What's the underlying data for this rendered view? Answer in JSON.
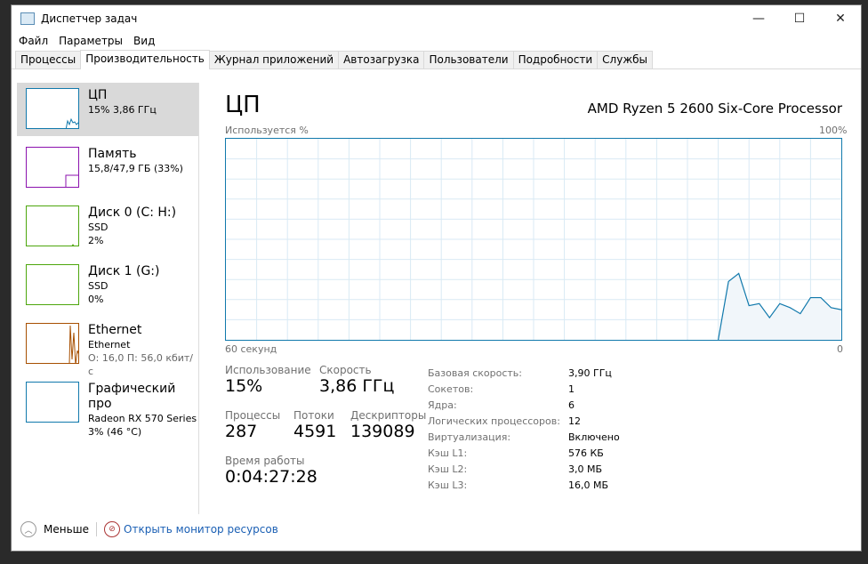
{
  "window": {
    "title": "Диспетчер задач",
    "minimize": "—",
    "maximize": "☐",
    "close": "✕"
  },
  "menu": [
    "Файл",
    "Параметры",
    "Вид"
  ],
  "tabs": [
    "Процессы",
    "Производительность",
    "Журнал приложений",
    "Автозагрузка",
    "Пользователи",
    "Подробности",
    "Службы"
  ],
  "devices": [
    {
      "name": "ЦП",
      "line1": "15% 3,86 ГГц",
      "line2": "",
      "color": "#1179ac"
    },
    {
      "name": "Память",
      "line1": "15,8/47,9 ГБ (33%)",
      "line2": "",
      "color": "#8b12ae"
    },
    {
      "name": "Диск 0 (C: H:)",
      "line1": "SSD",
      "line2": "2%",
      "color": "#4da60c"
    },
    {
      "name": "Диск 1 (G:)",
      "line1": "SSD",
      "line2": "0%",
      "color": "#4da60c"
    },
    {
      "name": "Ethernet",
      "line1": "Ethernet",
      "line2": "О: 16,0 П: 56,0 кбит/с",
      "color": "#a74f01"
    },
    {
      "name": "Графический про",
      "line1": "Radeon RX 570 Series",
      "line2": "3% (46 °C)",
      "color": "#1179ac"
    }
  ],
  "main": {
    "title": "ЦП",
    "cpu_name": "AMD Ryzen 5 2600 Six-Core Processor",
    "y_label": "Используется %",
    "y_max": "100%",
    "x_left": "60 секунд",
    "x_right": "0",
    "stats": {
      "usage_label": "Использование",
      "usage": "15%",
      "speed_label": "Скорость",
      "speed": "3,86 ГГц",
      "proc_label": "Процессы",
      "proc": "287",
      "threads_label": "Потоки",
      "threads": "4591",
      "handles_label": "Дескрипторы",
      "handles": "139089",
      "uptime_label": "Время работы",
      "uptime": "0:04:27:28"
    },
    "info": [
      [
        "Базовая скорость:",
        "3,90 ГГц"
      ],
      [
        "Сокетов:",
        "1"
      ],
      [
        "Ядра:",
        "6"
      ],
      [
        "Логических процессоров:",
        "12"
      ],
      [
        "Виртуализация:",
        "Включено"
      ],
      [
        "Кэш L1:",
        "576 КБ"
      ],
      [
        "Кэш L2:",
        "3,0 МБ"
      ],
      [
        "Кэш L3:",
        "16,0 МБ"
      ]
    ]
  },
  "footer": {
    "less": "Меньше",
    "monitor": "Открыть монитор ресурсов"
  },
  "chart_data": {
    "type": "area",
    "x_range_seconds": [
      60,
      0
    ],
    "ylim": [
      0,
      100
    ],
    "color": "#1179ac",
    "values": [
      0,
      0,
      0,
      0,
      0,
      0,
      0,
      0,
      0,
      0,
      0,
      0,
      0,
      0,
      0,
      0,
      0,
      0,
      0,
      0,
      0,
      0,
      0,
      0,
      0,
      0,
      0,
      0,
      0,
      0,
      0,
      0,
      0,
      0,
      0,
      0,
      0,
      0,
      0,
      0,
      0,
      0,
      0,
      0,
      0,
      0,
      0,
      0,
      0,
      29,
      33,
      17,
      18,
      11,
      18,
      16,
      13,
      21,
      21,
      16,
      15
    ]
  }
}
